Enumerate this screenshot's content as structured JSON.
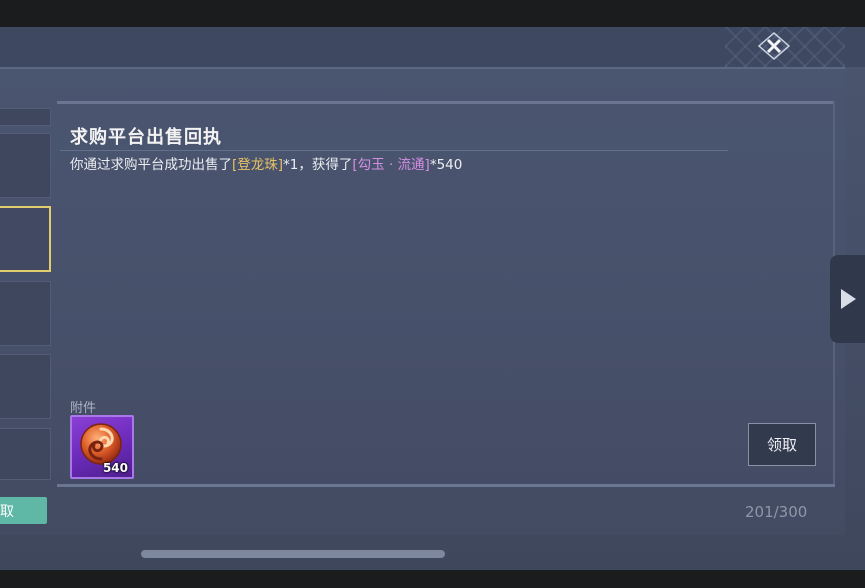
{
  "mail": {
    "title": "求购平台出售回执",
    "body_prefix": "你通过求购平台成功出售了",
    "sold_item": "[登龙珠]",
    "sold_qty": "*1，获得了",
    "received_item": "[勾玉 · 流通]",
    "received_qty": "*540"
  },
  "attachment": {
    "label": "附件",
    "item_icon": "magatama-coin-icon",
    "quantity": "540"
  },
  "actions": {
    "claim_label": "领取",
    "bulk_claim_label": "取"
  },
  "mailbox": {
    "count": "201/300"
  },
  "colors": {
    "gold_highlight": "#e4c164",
    "purple_highlight": "#d58fe6",
    "selected_border": "#e2cd6c",
    "green_button": "#5fb7a6"
  }
}
